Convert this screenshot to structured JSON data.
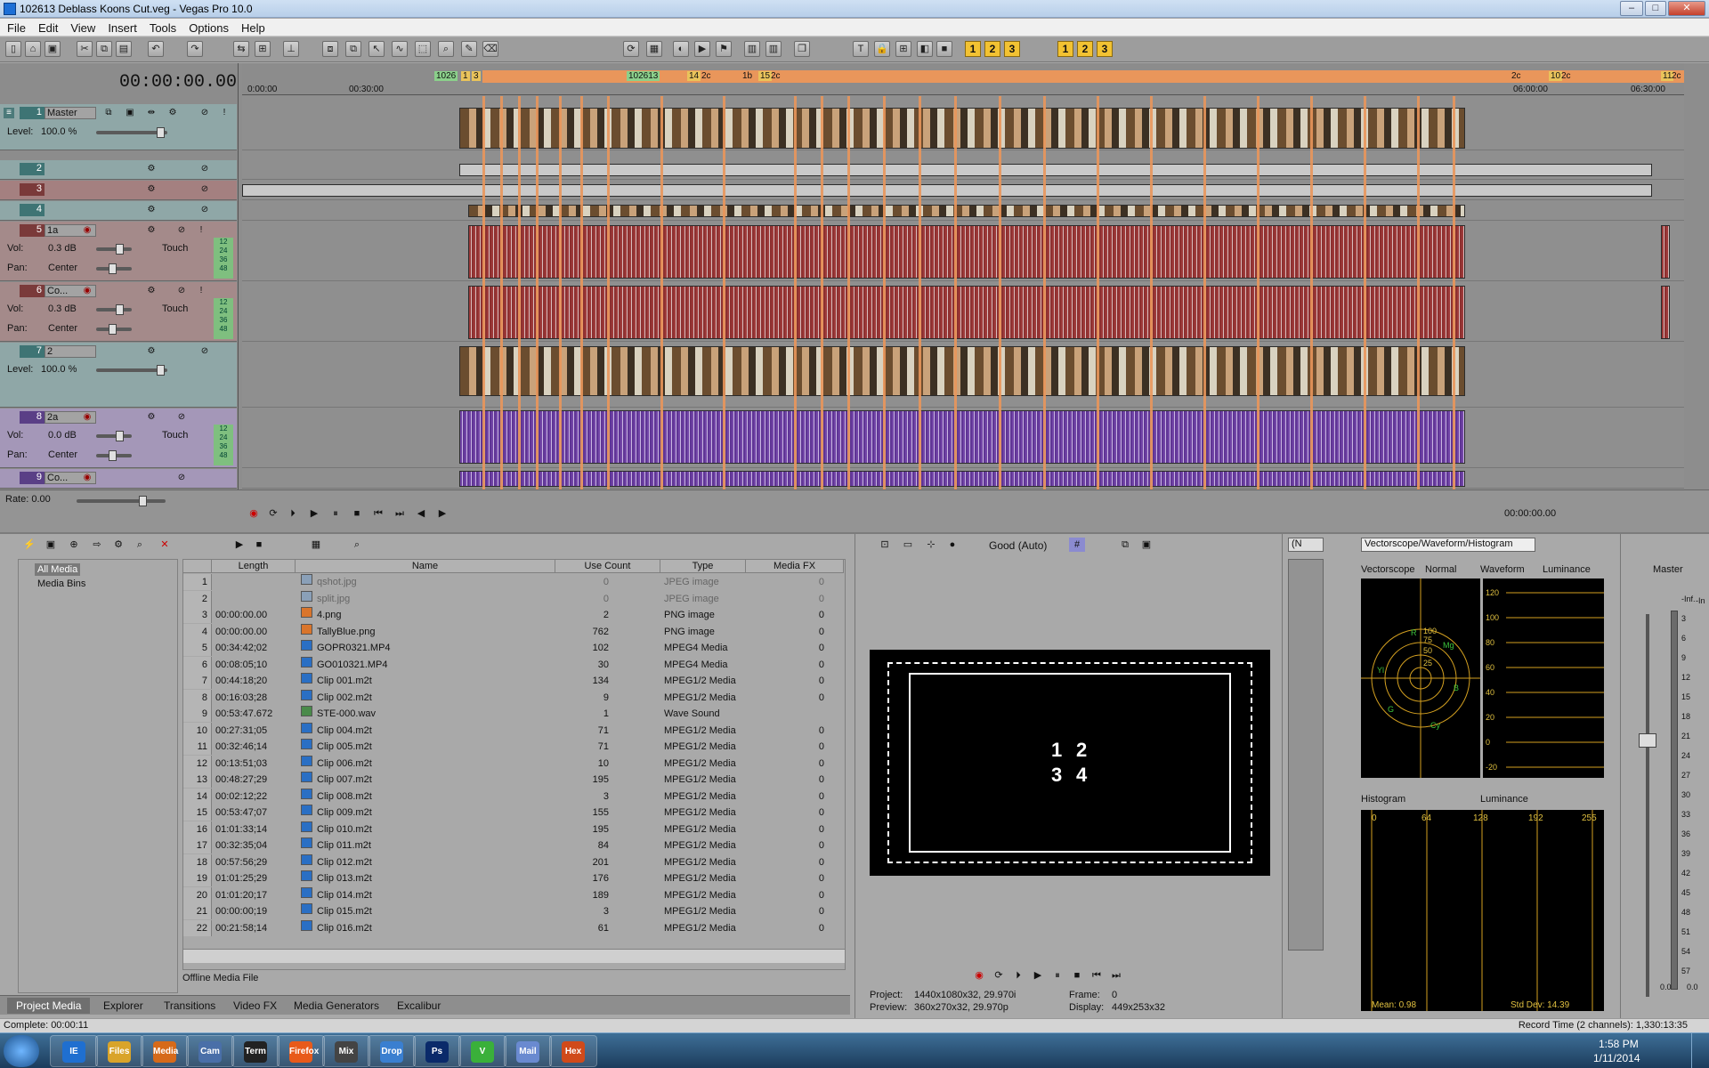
{
  "window": {
    "title": "102613 Deblass Koons Cut.veg - Vegas Pro 10.0",
    "min": "–",
    "max": "□",
    "close": "✕"
  },
  "menu": [
    "File",
    "Edit",
    "View",
    "Insert",
    "Tools",
    "Options",
    "Help"
  ],
  "toolbar": {
    "num1": "1",
    "num2": "2",
    "num3": "3"
  },
  "timeline": {
    "timecode": "00:00:00.00",
    "ruler_ticks": [
      "0:00:00",
      "00:30:00",
      "06:00:00",
      "06:30:00"
    ],
    "markers": [
      "1026",
      "1",
      "3",
      "1",
      "102613",
      "14",
      "2c",
      "1b",
      "15",
      "2c",
      "2c",
      "10",
      "2c",
      "11",
      "2c"
    ],
    "tracks": [
      {
        "num": "1",
        "name": "Master",
        "level_label": "Level:",
        "level": "100.0 %"
      },
      {
        "num": "2",
        "name": ""
      },
      {
        "num": "3",
        "name": ""
      },
      {
        "num": "4",
        "name": ""
      },
      {
        "num": "5",
        "name": "1a",
        "vol_label": "Vol:",
        "vol": "0.3 dB",
        "mode": "Touch",
        "pan_label": "Pan:",
        "pan": "Center",
        "meter": [
          "12",
          "24",
          "36",
          "48"
        ]
      },
      {
        "num": "6",
        "name": "Co...",
        "vol_label": "Vol:",
        "vol": "0.3 dB",
        "mode": "Touch",
        "pan_label": "Pan:",
        "pan": "Center",
        "meter": [
          "12",
          "24",
          "36",
          "48"
        ]
      },
      {
        "num": "7",
        "name": "2",
        "level_label": "Level:",
        "level": "100.0 %"
      },
      {
        "num": "8",
        "name": "2a",
        "vol_label": "Vol:",
        "vol": "0.0 dB",
        "mode": "Touch",
        "pan_label": "Pan:",
        "pan": "Center",
        "meter": [
          "12",
          "24",
          "36",
          "48"
        ]
      },
      {
        "num": "9",
        "name": "Co..."
      }
    ],
    "rate": "Rate: 0.00",
    "cursor_time": "00:00:00.00"
  },
  "media": {
    "tree": [
      "All Media",
      "Media Bins"
    ],
    "columns": [
      "Length",
      "Name",
      "Use Count",
      "Type",
      "Media FX"
    ],
    "rows": [
      {
        "n": "1",
        "length": "",
        "name": "qshot.jpg",
        "count": "0",
        "type": "JPEG image",
        "fx": "0",
        "icon": "img"
      },
      {
        "n": "2",
        "length": "",
        "name": "split.jpg",
        "count": "0",
        "type": "JPEG image",
        "fx": "0",
        "icon": "img"
      },
      {
        "n": "3",
        "length": "00:00:00.00",
        "name": "4.png",
        "count": "2",
        "type": "PNG image",
        "fx": "0",
        "icon": "png"
      },
      {
        "n": "4",
        "length": "00:00:00.00",
        "name": "TallyBlue.png",
        "count": "762",
        "type": "PNG image",
        "fx": "0",
        "icon": "png"
      },
      {
        "n": "5",
        "length": "00:34:42;02",
        "name": "GOPR0321.MP4",
        "count": "102",
        "type": "MPEG4 Media",
        "fx": "0",
        "icon": "mp4"
      },
      {
        "n": "6",
        "length": "00:08:05;10",
        "name": "GO010321.MP4",
        "count": "30",
        "type": "MPEG4 Media",
        "fx": "0",
        "icon": "mp4"
      },
      {
        "n": "7",
        "length": "00:44:18;20",
        "name": "Clip 001.m2t",
        "count": "134",
        "type": "MPEG1/2 Media",
        "fx": "0",
        "icon": "m2t"
      },
      {
        "n": "8",
        "length": "00:16:03;28",
        "name": "Clip 002.m2t",
        "count": "9",
        "type": "MPEG1/2 Media",
        "fx": "0",
        "icon": "m2t"
      },
      {
        "n": "9",
        "length": "00:53:47.672",
        "name": "STE-000.wav",
        "count": "1",
        "type": "Wave Sound",
        "fx": "",
        "icon": "wav"
      },
      {
        "n": "10",
        "length": "00:27:31;05",
        "name": "Clip 004.m2t",
        "count": "71",
        "type": "MPEG1/2 Media",
        "fx": "0",
        "icon": "m2t"
      },
      {
        "n": "11",
        "length": "00:32:46;14",
        "name": "Clip 005.m2t",
        "count": "71",
        "type": "MPEG1/2 Media",
        "fx": "0",
        "icon": "m2t"
      },
      {
        "n": "12",
        "length": "00:13:51;03",
        "name": "Clip 006.m2t",
        "count": "10",
        "type": "MPEG1/2 Media",
        "fx": "0",
        "icon": "m2t"
      },
      {
        "n": "13",
        "length": "00:48:27;29",
        "name": "Clip 007.m2t",
        "count": "195",
        "type": "MPEG1/2 Media",
        "fx": "0",
        "icon": "m2t"
      },
      {
        "n": "14",
        "length": "00:02:12;22",
        "name": "Clip 008.m2t",
        "count": "3",
        "type": "MPEG1/2 Media",
        "fx": "0",
        "icon": "m2t"
      },
      {
        "n": "15",
        "length": "00:53:47;07",
        "name": "Clip 009.m2t",
        "count": "155",
        "type": "MPEG1/2 Media",
        "fx": "0",
        "icon": "m2t"
      },
      {
        "n": "16",
        "length": "01:01:33;14",
        "name": "Clip 010.m2t",
        "count": "195",
        "type": "MPEG1/2 Media",
        "fx": "0",
        "icon": "m2t"
      },
      {
        "n": "17",
        "length": "00:32:35;04",
        "name": "Clip 011.m2t",
        "count": "84",
        "type": "MPEG1/2 Media",
        "fx": "0",
        "icon": "m2t"
      },
      {
        "n": "18",
        "length": "00:57:56;29",
        "name": "Clip 012.m2t",
        "count": "201",
        "type": "MPEG1/2 Media",
        "fx": "0",
        "icon": "m2t"
      },
      {
        "n": "19",
        "length": "01:01:25;29",
        "name": "Clip 013.m2t",
        "count": "176",
        "type": "MPEG1/2 Media",
        "fx": "0",
        "icon": "m2t"
      },
      {
        "n": "20",
        "length": "01:01:20;17",
        "name": "Clip 014.m2t",
        "count": "189",
        "type": "MPEG1/2 Media",
        "fx": "0",
        "icon": "m2t"
      },
      {
        "n": "21",
        "length": "00:00:00;19",
        "name": "Clip 015.m2t",
        "count": "3",
        "type": "MPEG1/2 Media",
        "fx": "0",
        "icon": "m2t"
      },
      {
        "n": "22",
        "length": "00:21:58;14",
        "name": "Clip 016.m2t",
        "count": "61",
        "type": "MPEG1/2 Media",
        "fx": "0",
        "icon": "m2t"
      }
    ],
    "offline_label": "Offline Media File"
  },
  "tabs": [
    "Project Media",
    "Explorer",
    "Transitions",
    "Video FX",
    "Media Generators",
    "Excalibur"
  ],
  "preview": {
    "quality": "Good (Auto)",
    "screen_text": [
      "1",
      "2",
      "3",
      "4"
    ],
    "project_label": "Project:",
    "project": "1440x1080x32, 29.970i",
    "preview_label": "Preview:",
    "preview": "360x270x32, 29.970p",
    "frame_label": "Frame:",
    "frame": "0",
    "display_label": "Display:",
    "display": "449x253x32"
  },
  "scopes": {
    "selector": "Vectorscope/Waveform/Histogram",
    "small_dropdown": "(N",
    "vectorscope_label": "Vectorscope",
    "vectorscope_mode": "Normal",
    "vectorscope_marks": [
      "100",
      "75",
      "50",
      "25",
      "R",
      "Mg",
      "B",
      "Cy",
      "G",
      "Yl"
    ],
    "waveform_label": "Waveform",
    "waveform_mode": "Luminance",
    "waveform_ticks": [
      "120",
      "100",
      "80",
      "60",
      "40",
      "20",
      "0",
      "-20"
    ],
    "histogram_label": "Histogram",
    "histogram_mode": "Luminance",
    "histogram_ticks": [
      "0",
      "64",
      "128",
      "192",
      "255"
    ],
    "mean": "Mean: 0.98",
    "stddev": "Std Dev: 14.39"
  },
  "master": {
    "label": "Master",
    "ticks": [
      "-Inf.",
      "3",
      "6",
      "9",
      "12",
      "15",
      "18",
      "21",
      "24",
      "27",
      "30",
      "33",
      "36",
      "39",
      "42",
      "45",
      "48",
      "51",
      "54",
      "57"
    ],
    "top_right": "-In",
    "vals": [
      "0.0",
      "0.0"
    ]
  },
  "status": {
    "left": "Complete: 00:00:11",
    "right": "Record Time (2 channels): 1,330:13:35"
  },
  "taskbar": {
    "time": "1:58 PM",
    "date": "1/11/2014",
    "apps": [
      "IE",
      "Files",
      "Media",
      "Cam",
      "Term",
      "Firefox",
      "Mix",
      "Drop",
      "Ps",
      "V",
      "Mail",
      "Hex"
    ]
  }
}
